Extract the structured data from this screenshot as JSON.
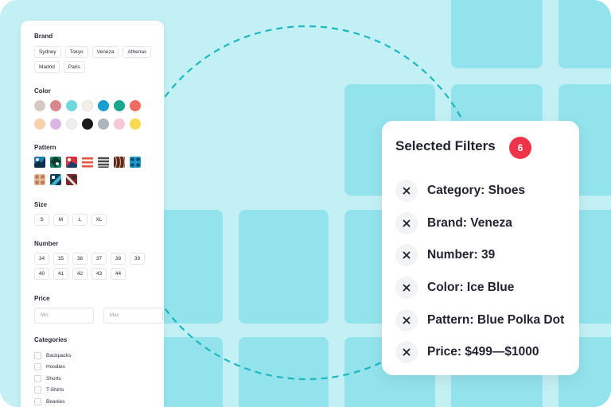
{
  "colors": {
    "background": "#c3f0f5",
    "tile": "#93e3ec",
    "dashed_circle": "#1bb8bf",
    "badge": "#ef3349"
  },
  "sidebar": {
    "brand": {
      "title": "Brand",
      "options": [
        "Sydney",
        "Tokyo",
        "Veneza",
        "Athenas",
        "Madrid",
        "Paris"
      ]
    },
    "color": {
      "title": "Color",
      "swatches": [
        "#d6c9c2",
        "#d9868c",
        "#6fd8dd",
        "#f6efe6",
        "#169fd0",
        "#17a88e",
        "#f36b5e",
        "#f9d2ad",
        "#dcb6e3",
        "#efefef",
        "#1a1a1a",
        "#adb5ba",
        "#f8c6d6",
        "#f9d94e"
      ]
    },
    "pattern": {
      "title": "Pattern",
      "count": 10
    },
    "size": {
      "title": "Size",
      "options": [
        "S",
        "M",
        "L",
        "XL"
      ]
    },
    "number": {
      "title": "Number",
      "options": [
        "34",
        "35",
        "36",
        "37",
        "38",
        "39",
        "40",
        "41",
        "42",
        "43",
        "44"
      ]
    },
    "price": {
      "title": "Price",
      "min_placeholder": "Min",
      "max_placeholder": "Max"
    },
    "categories": {
      "title": "Categories",
      "items": [
        "Backpacks",
        "Hoodies",
        "Shorts",
        "T-Shirts",
        "Beanies"
      ]
    }
  },
  "selected_filters": {
    "title": "Selected Filters",
    "count": "6",
    "items": [
      "Category: Shoes",
      "Brand: Veneza",
      "Number: 39",
      "Color: Ice Blue",
      "Pattern: Blue Polka Dot",
      "Price: $499—$1000"
    ],
    "remove_icon": "close-icon"
  }
}
